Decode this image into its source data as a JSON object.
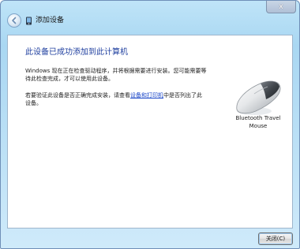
{
  "window": {
    "title": "添加设备",
    "close_glyph": "x"
  },
  "main": {
    "heading": "此设备已成功添加到此计算机",
    "paragraph1": "Windows 现在正在检查驱动程序，并将根据需要进行安装。您可能需要等待此检查完成，才可以使用此设备。",
    "paragraph2_before": "若要验证此设备是否正确完成安装，请查看",
    "paragraph2_link": "设备和打印机",
    "paragraph2_after": "中是否列出了此设备。"
  },
  "device": {
    "name_line1": "Bluetooth Travel",
    "name_line2": "Mouse",
    "icon": "mouse-icon"
  },
  "footer": {
    "close_button_label": "关闭(C)"
  },
  "colors": {
    "heading": "#1f3f9f",
    "link": "#1a46c8",
    "titlebar": "#a9d7f2"
  }
}
